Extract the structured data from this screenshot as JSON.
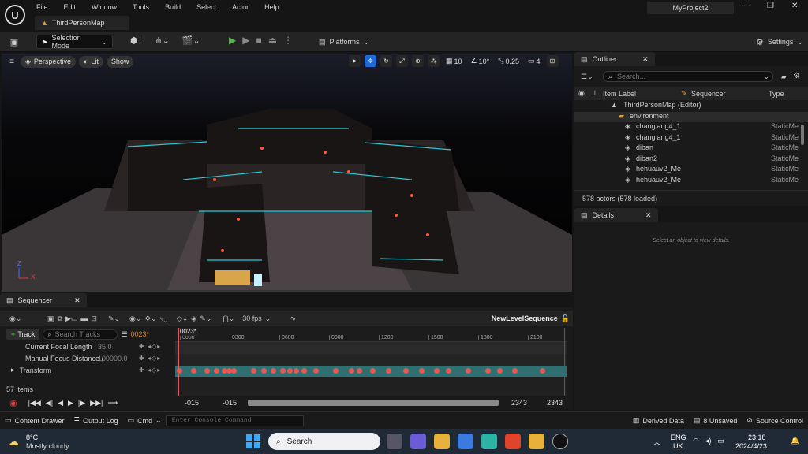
{
  "menu": [
    "File",
    "Edit",
    "Window",
    "Tools",
    "Build",
    "Select",
    "Actor",
    "Help"
  ],
  "window": {
    "project": "MyProject2",
    "map_tab": "ThirdPersonMap",
    "min": "—",
    "max": "❐",
    "close": "✕"
  },
  "toolbar": {
    "selection_mode": "Selection Mode",
    "platforms": "Platforms",
    "settings": "Settings"
  },
  "viewport": {
    "perspective": "Perspective",
    "lit": "Lit",
    "show": "Show",
    "grid": "10",
    "angle": "10°",
    "scale": "0.25",
    "cams": "4",
    "axis_z": "Z",
    "axis_x": "X"
  },
  "outliner": {
    "title": "Outliner",
    "search_placeholder": "Search...",
    "col_label": "Item Label",
    "col_sequencer": "Sequencer",
    "col_type": "Type",
    "rows": [
      {
        "label": "ThirdPersonMap (Editor)",
        "type": ""
      },
      {
        "label": "environment",
        "type": ""
      },
      {
        "label": "changlang4_1",
        "type": "StaticMe"
      },
      {
        "label": "changlang4_1",
        "type": "StaticMe"
      },
      {
        "label": "diban",
        "type": "StaticMe"
      },
      {
        "label": "diban2",
        "type": "StaticMe"
      },
      {
        "label": "hehuauv2_Me",
        "type": "StaticMe"
      },
      {
        "label": "hehuauv2_Me",
        "type": "StaticMe"
      }
    ],
    "footer": "578 actors (578 loaded)"
  },
  "details": {
    "title": "Details",
    "empty": "Select an object to view details."
  },
  "sequencer": {
    "title": "Sequencer",
    "fps": "30 fps",
    "sequence_name": "NewLevelSequence",
    "add_track": "Track",
    "search_placeholder": "Search Tracks",
    "current_frame": "0023*",
    "playhead": "0023*",
    "ticks": [
      "0000",
      "0300",
      "0600",
      "0900",
      "1200",
      "1500",
      "1800",
      "2100"
    ],
    "tracks": [
      {
        "name": "Current Focal Length",
        "value": "35.0"
      },
      {
        "name": "Manual Focus Distance (",
        "value": "100000.0"
      },
      {
        "name": "Transform",
        "value": ""
      }
    ],
    "items_count": "57 items",
    "range_start": "-015",
    "range_start2": "-015",
    "range_end": "2343",
    "range_end2": "2343",
    "keyframes": [
      0,
      18,
      35,
      48,
      58,
      64,
      70,
      95,
      108,
      120,
      132,
      142,
      150,
      160,
      175,
      200,
      220,
      230,
      248,
      268,
      290,
      310,
      330,
      345,
      370,
      395,
      410,
      430,
      465
    ],
    "transform_keys_total_frames": 465
  },
  "bottom": {
    "content_drawer": "Content Drawer",
    "output_log": "Output Log",
    "cmd": "Cmd",
    "console_placeholder": "Enter Console Command",
    "derived": "Derived Data",
    "unsaved": "8 Unsaved",
    "source": "Source Control"
  },
  "taskbar": {
    "temp": "8°C",
    "weather": "Mostly cloudy",
    "search": "Search",
    "lang1": "ENG",
    "lang2": "UK",
    "time": "23:18",
    "date": "2024/4/23"
  },
  "colors": {
    "accent": "#1f6ad6",
    "play_green": "#5ab14f",
    "key_red": "#e05a5a",
    "track_teal": "#2f6f72",
    "timeline_orange": "#e08a2c"
  }
}
